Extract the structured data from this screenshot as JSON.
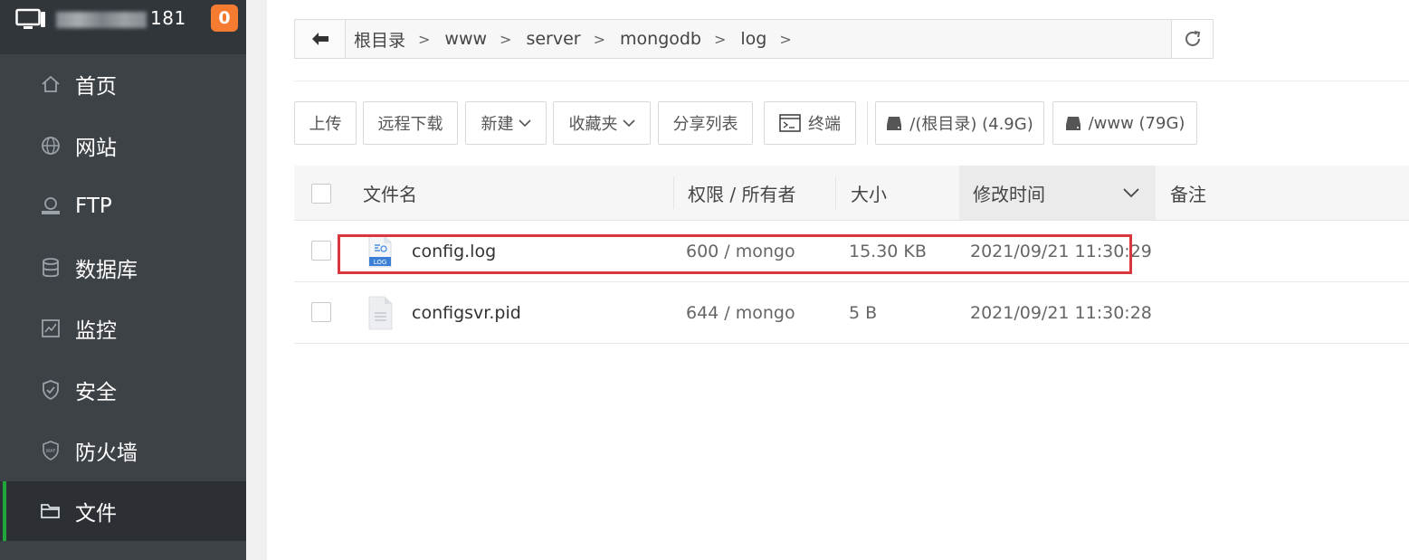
{
  "sidebar": {
    "ip_suffix": "181",
    "badge": "0",
    "items": [
      {
        "label": "首页",
        "icon": "home-icon"
      },
      {
        "label": "网站",
        "icon": "globe-icon"
      },
      {
        "label": "FTP",
        "icon": "ftp-icon"
      },
      {
        "label": "数据库",
        "icon": "database-icon"
      },
      {
        "label": "监控",
        "icon": "monitor-icon"
      },
      {
        "label": "安全",
        "icon": "shield-icon"
      },
      {
        "label": "防火墙",
        "icon": "waf-icon"
      },
      {
        "label": "文件",
        "icon": "folder-icon",
        "active": true
      }
    ]
  },
  "path": {
    "crumbs": [
      "根目录",
      "www",
      "server",
      "mongodb",
      "log"
    ]
  },
  "toolbar": {
    "upload": "上传",
    "remote_download": "远程下载",
    "new": "新建",
    "favorites": "收藏夹",
    "share_list": "分享列表",
    "terminal": "终端",
    "disk_root": "/(根目录) (4.9G)",
    "disk_www": "/www (79G)"
  },
  "table": {
    "headers": {
      "filename": "文件名",
      "permission": "权限 / 所有者",
      "size": "大小",
      "mtime": "修改时间",
      "remark": "备注"
    },
    "rows": [
      {
        "name": "config.log",
        "perm": "600 / mongo",
        "size": "15.30 KB",
        "mtime": "2021/09/21 11:30:29",
        "icon": "log-file-icon"
      },
      {
        "name": "configsvr.pid",
        "perm": "644 / mongo",
        "size": "5 B",
        "mtime": "2021/09/21 11:30:28",
        "icon": "text-file-icon"
      }
    ]
  },
  "colors": {
    "sidebar_bg": "#3d4247",
    "active_accent": "#20a53a",
    "badge": "#f47b30",
    "highlight": "#d9363e"
  }
}
